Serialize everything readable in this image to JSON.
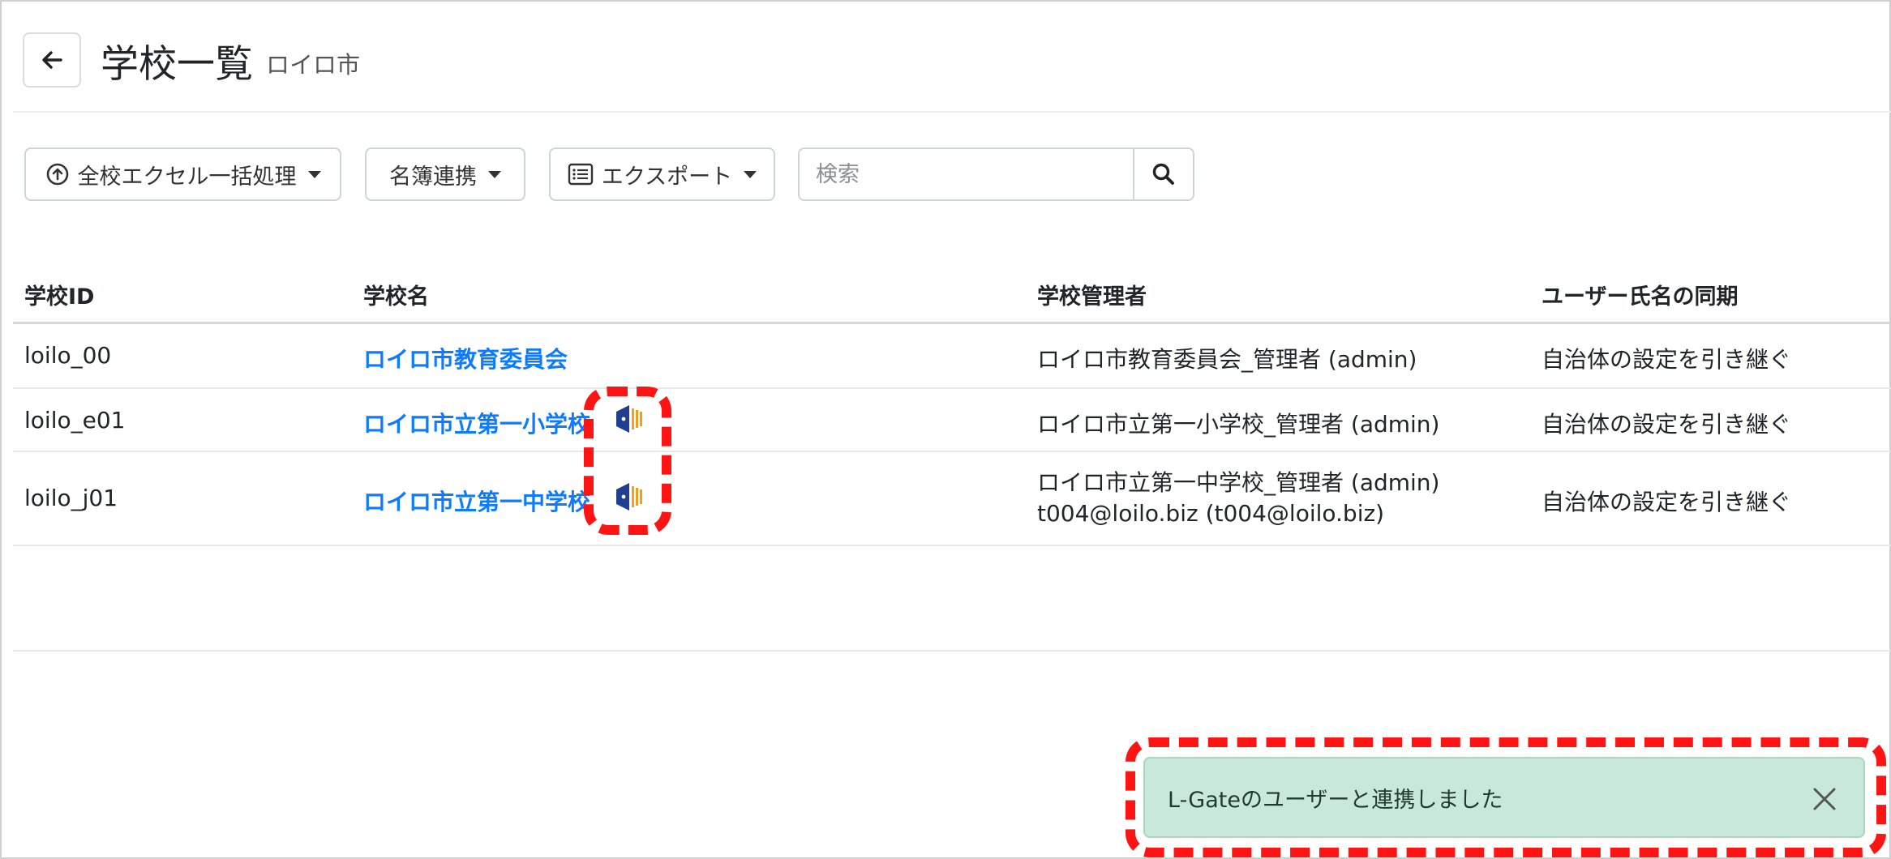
{
  "header": {
    "title": "学校一覧",
    "subtitle": "ロイロ市"
  },
  "toolbar": {
    "excel_label": "全校エクセル一括処理",
    "roster_label": "名簿連携",
    "export_label": "エクスポート",
    "search_placeholder": "検索"
  },
  "table": {
    "columns": [
      "学校ID",
      "学校名",
      "学校管理者",
      "ユーザー氏名の同期"
    ],
    "rows": [
      {
        "id": "loilo_00",
        "name": "ロイロ市教育委員会",
        "admins": [
          "ロイロ市教育委員会_管理者 (admin)"
        ],
        "sync": "自治体の設定を引き継ぐ",
        "lgate_linked": false
      },
      {
        "id": "loilo_e01",
        "name": "ロイロ市立第一小学校",
        "admins": [
          "ロイロ市立第一小学校_管理者 (admin)"
        ],
        "sync": "自治体の設定を引き継ぐ",
        "lgate_linked": true
      },
      {
        "id": "loilo_j01",
        "name": "ロイロ市立第一中学校",
        "admins": [
          "ロイロ市立第一中学校_管理者 (admin)",
          "t004@loilo.biz (t004@loilo.biz)"
        ],
        "sync": "自治体の設定を引き継ぐ",
        "lgate_linked": true
      }
    ]
  },
  "toast": {
    "message": "L-Gateのユーザーと連携しました"
  },
  "icons": {
    "back": "arrow-left-icon",
    "upload": "circle-arrow-up-icon",
    "export": "list-icon",
    "search": "magnifier-icon",
    "lgate": "l-gate-logo-icon",
    "close": "close-icon"
  },
  "colors": {
    "link": "#0d7bff",
    "toast_bg": "#c8e8da",
    "annotation": "#ff1414",
    "lgate_blue": "#1f3f8f",
    "lgate_orange": "#f0a020"
  }
}
